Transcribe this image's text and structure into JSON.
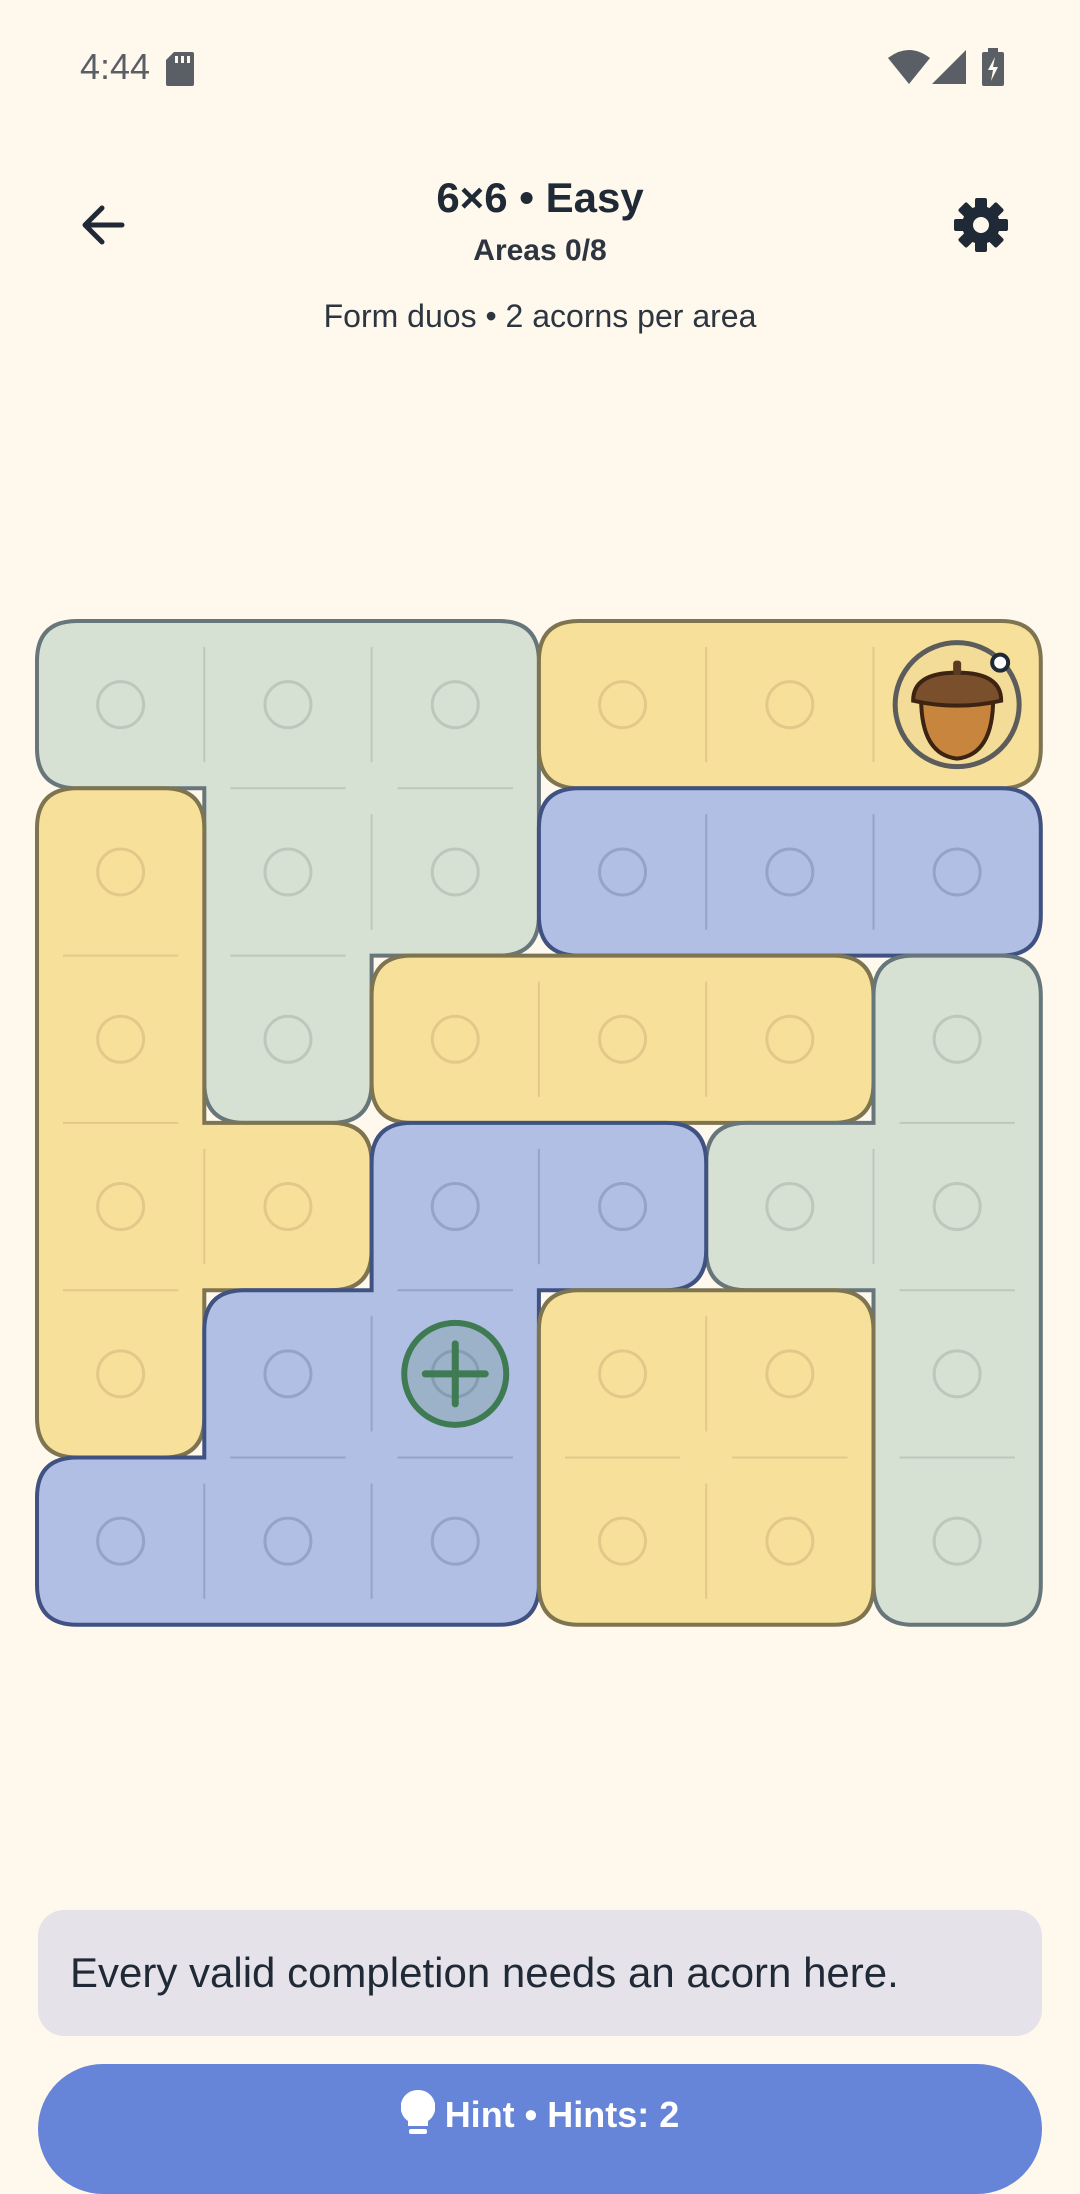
{
  "status_bar": {
    "time": "4:44"
  },
  "header": {
    "title": "6×6 • Easy",
    "subtitle": "Areas 0/8",
    "rules": "Form duos • 2 acorns per area"
  },
  "icons": {
    "back": "arrow-left-icon",
    "settings": "gear-icon",
    "acorn": "acorn-icon",
    "hint_marker": "plus-circle-icon",
    "hint_button": "lightbulb-icon"
  },
  "colors": {
    "background": "#fff8ec",
    "green_area": "#d7e1d3",
    "yellow_area": "#f7e19a",
    "blue_area": "#b0bfe3",
    "hint_button": "#6685d8",
    "hint_marker": "#3e7a52"
  },
  "grid": {
    "rows": 6,
    "cols": 6,
    "areas": [
      {
        "color": "green",
        "cells": [
          [
            0,
            0
          ],
          [
            0,
            1
          ],
          [
            0,
            2
          ],
          [
            1,
            1
          ],
          [
            1,
            2
          ],
          [
            2,
            1
          ]
        ]
      },
      {
        "color": "yellow",
        "cells": [
          [
            0,
            3
          ],
          [
            0,
            4
          ],
          [
            0,
            5
          ]
        ]
      },
      {
        "color": "blue",
        "cells": [
          [
            1,
            3
          ],
          [
            1,
            4
          ],
          [
            1,
            5
          ]
        ]
      },
      {
        "color": "yellow",
        "cells": [
          [
            1,
            0
          ],
          [
            2,
            0
          ],
          [
            3,
            0
          ],
          [
            3,
            1
          ],
          [
            4,
            0
          ]
        ]
      },
      {
        "color": "yellow",
        "cells": [
          [
            2,
            2
          ],
          [
            2,
            3
          ],
          [
            2,
            4
          ]
        ]
      },
      {
        "color": "green",
        "cells": [
          [
            2,
            5
          ],
          [
            3,
            4
          ],
          [
            3,
            5
          ],
          [
            4,
            5
          ],
          [
            5,
            5
          ]
        ]
      },
      {
        "color": "blue",
        "cells": [
          [
            3,
            2
          ],
          [
            3,
            3
          ],
          [
            4,
            1
          ],
          [
            4,
            2
          ],
          [
            5,
            0
          ],
          [
            5,
            1
          ],
          [
            5,
            2
          ]
        ]
      },
      {
        "color": "yellow",
        "cells": [
          [
            4,
            3
          ],
          [
            4,
            4
          ],
          [
            5,
            3
          ],
          [
            5,
            4
          ]
        ]
      }
    ],
    "acorns": [
      [
        0,
        5
      ]
    ],
    "hint_cells": [
      [
        4,
        2
      ]
    ]
  },
  "hint": {
    "message": "Every valid completion needs an acorn here.",
    "button_label": "Hint • Hints: 2"
  }
}
